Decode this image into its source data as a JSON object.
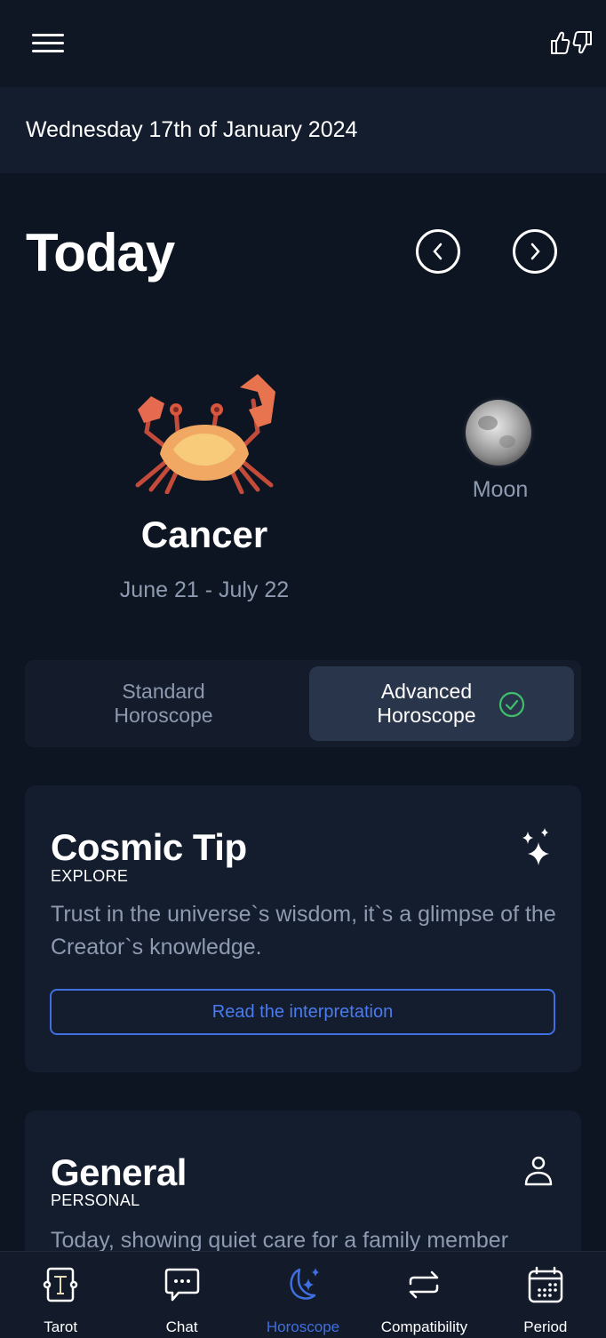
{
  "header": {
    "menu_icon": "hamburger-menu-icon",
    "feedback_icons": [
      "thumbs-up-icon",
      "thumbs-down-icon"
    ]
  },
  "date_bar": {
    "date": "Wednesday 17th of January 2024"
  },
  "day_nav": {
    "title": "Today",
    "prev_icon": "chevron-left-circle-icon",
    "next_icon": "chevron-right-circle-icon"
  },
  "sign": {
    "name": "Cancer",
    "dates": "June 21 - July 22",
    "image": "crab-image",
    "planet_label": "Moon",
    "planet_image": "moon-image"
  },
  "horoscope_toggle": {
    "options": [
      {
        "label_line1": "Standard",
        "label_line2": "Horoscope",
        "selected": false
      },
      {
        "label_line1": "Advanced",
        "label_line2": "Horoscope",
        "selected": true
      }
    ],
    "selected_icon": "check-circle-icon",
    "check_color": "#3fbf6a"
  },
  "cards": [
    {
      "title": "Cosmic Tip",
      "subtitle": "EXPLORE",
      "icon": "sparkles-icon",
      "text": "Trust in the universe`s wisdom, it`s a glimpse of the Creator`s knowledge.",
      "button_label": "Read the interpretation"
    },
    {
      "title": "General",
      "subtitle": "PERSONAL",
      "icon": "person-icon",
      "text": "Today, showing quiet care for a family member"
    }
  ],
  "bottom_nav": {
    "active_color": "#3f6fe0",
    "items": [
      {
        "label": "Tarot",
        "icon": "tarot-card-icon",
        "active": false
      },
      {
        "label": "Chat",
        "icon": "chat-bubble-icon",
        "active": false
      },
      {
        "label": "Horoscope",
        "icon": "moon-stars-icon",
        "active": true
      },
      {
        "label": "Compatibility",
        "icon": "swap-arrows-icon",
        "active": false
      },
      {
        "label": "Period",
        "icon": "calendar-icon",
        "active": false
      }
    ]
  }
}
